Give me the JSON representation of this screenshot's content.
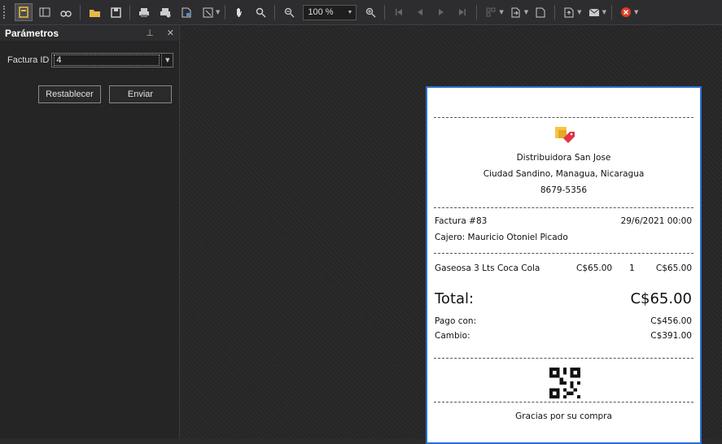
{
  "toolbar": {
    "zoom_value": "100 %"
  },
  "panel": {
    "title": "Parámetros",
    "pin_glyph": "⊥",
    "close_glyph": "✕",
    "param_label": "Factura ID",
    "param_value": "4",
    "reset_label": "Restablecer",
    "submit_label": "Enviar"
  },
  "receipt": {
    "company": "Distribuidora San Jose",
    "address": "Ciudad Sandino, Managua, Nicaragua",
    "phone": "8679-5356",
    "invoice": "Factura #83",
    "date": "29/6/2021 00:00",
    "cashier": "Cajero: Mauricio Otoniel Picado",
    "items": [
      {
        "name": "Gaseosa 3 Lts Coca Cola",
        "price": "C$65.00",
        "qty": "1",
        "total": "C$65.00"
      }
    ],
    "total_label": "Total:",
    "total_value": "C$65.00",
    "paid_label": "Pago con:",
    "paid_value": "C$456.00",
    "change_label": "Cambio:",
    "change_value": "C$391.00",
    "footer": "Gracias por su compra"
  },
  "colors": {
    "page_border": "#2a6fd6",
    "close_accent": "#e03b24"
  }
}
